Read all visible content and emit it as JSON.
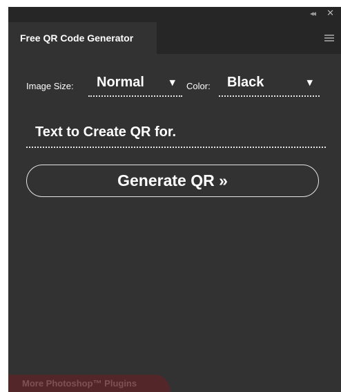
{
  "window": {
    "collapse_glyph": "◂◂",
    "close_glyph": "✕"
  },
  "tab": {
    "title": "Free QR Code Generator",
    "menu_icon": "hamburger-menu-icon"
  },
  "options": {
    "image_size_label": "Image Size:",
    "image_size_value": "Normal",
    "color_label": "Color:",
    "color_value": "Black",
    "dropdown_glyph": "▼"
  },
  "input": {
    "value": "Text to Create QR for."
  },
  "generate": {
    "label": "Generate QR »"
  },
  "footer": {
    "link_label": "More Photoshop™ Plugins"
  },
  "colors": {
    "panel_bg": "#323232",
    "bar_bg": "#262626",
    "text": "#ffffff",
    "footer_bg": "#53272a",
    "footer_text": "#7e5255"
  }
}
